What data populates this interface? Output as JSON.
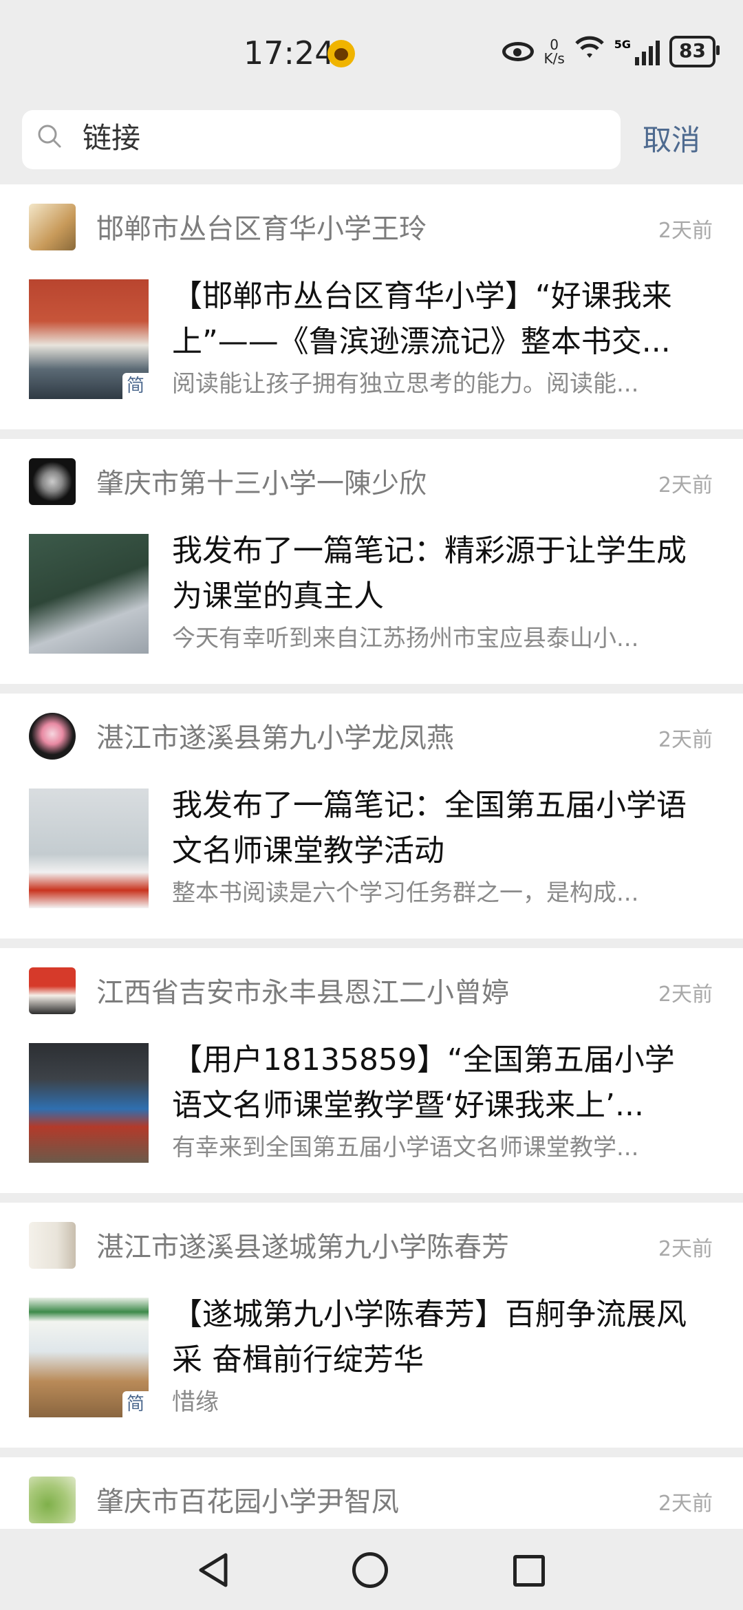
{
  "status_bar": {
    "time": "17:24",
    "net_speed_value": "0",
    "net_speed_unit": "K/s",
    "network": "5G",
    "battery": "83"
  },
  "search": {
    "value": "链接",
    "cancel_label": "取消"
  },
  "feed": [
    {
      "author": "邯郸市丛台区育华小学王玲",
      "time": "2天前",
      "title_line1": "【邯郸市丛台区育华小学】“好课我来",
      "title_line2": "上”——《鲁滨逊漂流记》整本书交...",
      "summary": "阅读能让孩子拥有独立思考的能力。阅读能...",
      "badge": "简"
    },
    {
      "author": "肇庆市第十三小学一陳少欣",
      "time": "2天前",
      "title_line1": "我发布了一篇笔记：精彩源于让学生成",
      "title_line2": "为课堂的真主人",
      "summary": "今天有幸听到来自江苏扬州市宝应县泰山小..."
    },
    {
      "author": "湛江市遂溪县第九小学龙凤燕",
      "time": "2天前",
      "title_line1": "我发布了一篇笔记：全国第五届小学语",
      "title_line2": "文名师课堂教学活动",
      "summary": "整本书阅读是六个学习任务群之一，是构成..."
    },
    {
      "author": "江西省吉安市永丰县恩江二小曾婷",
      "time": "2天前",
      "title_line1": "【用户18135859】“全国第五届小学",
      "title_line2": "语文名师课堂教学暨‘好课我来上’...",
      "summary": "有幸来到全国第五届小学语文名师课堂教学..."
    },
    {
      "author": "湛江市遂溪县遂城第九小学陈春芳",
      "time": "2天前",
      "title_line1": "【遂城第九小学陈春芳】百舸争流展风",
      "title_line2": "采 奋楫前行绽芳华",
      "summary": "惜缘",
      "badge": "简"
    },
    {
      "author": "肇庆市百花园小学尹智凤",
      "time": "2天前"
    }
  ],
  "colors": {
    "background": "#ededed",
    "link_blue": "#4e6a8f",
    "meta_gray": "#a8a8a8"
  }
}
